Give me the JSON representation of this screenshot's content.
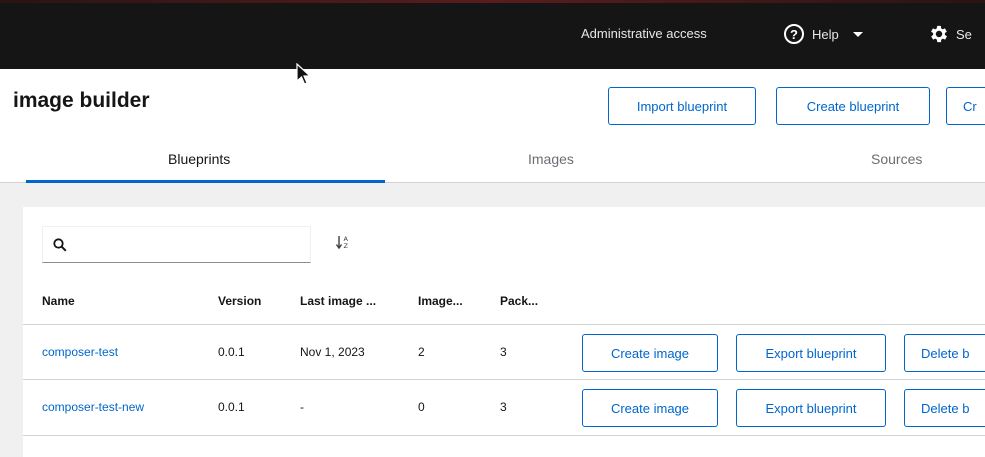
{
  "masthead": {
    "admin_label": "Administrative access",
    "help_label": "Help",
    "settings_label": "Se",
    "accent": "#151515"
  },
  "header": {
    "title": "image builder",
    "import_label": "Import blueprint",
    "create_label": "Create blueprint",
    "third_label": "Cr"
  },
  "tabs": [
    {
      "label": "Blueprints",
      "active": true
    },
    {
      "label": "Images",
      "active": false
    },
    {
      "label": "Sources",
      "active": false
    }
  ],
  "toolbar": {
    "search_value": "",
    "search_icon": "search-icon",
    "sort_icon": "sort-alpha-icon"
  },
  "table": {
    "columns": [
      "Name",
      "Version",
      "Last image ...",
      "Image...",
      "Pack..."
    ],
    "rows": [
      {
        "name": "composer-test",
        "version": "0.0.1",
        "last_image": "Nov 1, 2023",
        "images": "2",
        "packages": "3",
        "create_image": "Create image",
        "export": "Export blueprint",
        "delete": "Delete b"
      },
      {
        "name": "composer-test-new",
        "version": "0.0.1",
        "last_image": "-",
        "images": "0",
        "packages": "3",
        "create_image": "Create image",
        "export": "Export blueprint",
        "delete": "Delete b"
      }
    ]
  },
  "colors": {
    "link": "#0066cc",
    "masthead_bg": "#151515",
    "page_bg": "#f0f0f0"
  }
}
